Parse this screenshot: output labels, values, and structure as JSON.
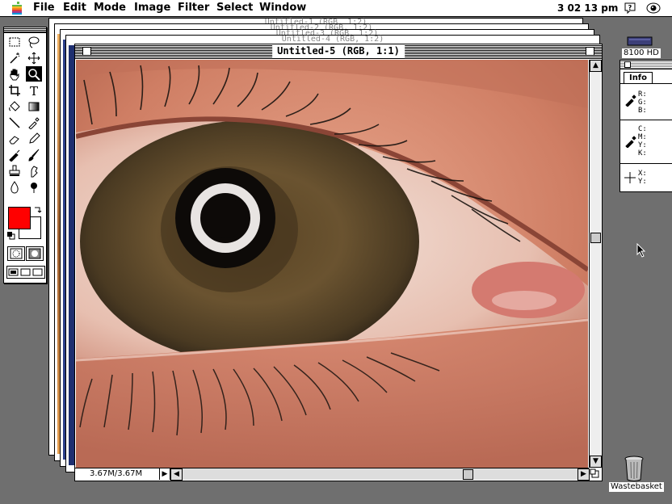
{
  "menubar": {
    "items": [
      "File",
      "Edit",
      "Mode",
      "Image",
      "Filter",
      "Select",
      "Window"
    ],
    "clock": "3 02 13 pm"
  },
  "document": {
    "title": "Untitled-5 (RGB, 1:1)",
    "background_titles": [
      "Untitled-1 (RGB, 1:2)",
      "Untitled-2 (RGB, 1:2)",
      "Untitled-3 (RGB, 1:2)",
      "Untitled-4 (RGB, 1:2)"
    ],
    "status": "3.67M/3.67M"
  },
  "tools": [
    "marquee",
    "lasso",
    "magic-wand",
    "move",
    "hand",
    "zoom",
    "crop",
    "type",
    "paint-bucket",
    "gradient",
    "line",
    "eyedropper",
    "eraser",
    "pencil",
    "airbrush",
    "paintbrush",
    "rubber-stamp",
    "smudge",
    "blur",
    "dodge"
  ],
  "colors": {
    "foreground": "#ff0000",
    "background": "#ffffff"
  },
  "info_palette": {
    "tab": "Info",
    "rgb_labels": [
      "R:",
      "G:",
      "B:"
    ],
    "cmyk_labels": [
      "C:",
      "M:",
      "Y:",
      "K:"
    ],
    "xy_labels": [
      "X:",
      "Y:"
    ]
  },
  "desktop": {
    "hd_label": "8100 HD",
    "trash_label": "Wastebasket"
  }
}
